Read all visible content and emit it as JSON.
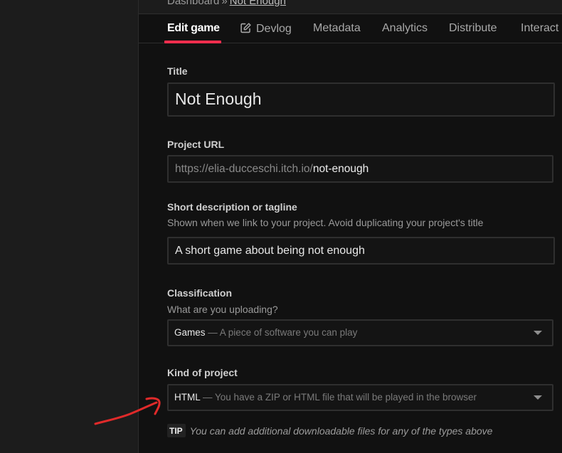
{
  "breadcrumb": {
    "root": "Dashboard",
    "separator": "»",
    "current": "Not Enough"
  },
  "tabs": [
    {
      "label": "Edit game",
      "active": true
    },
    {
      "label": "Devlog",
      "icon": "edit-pencil-icon"
    },
    {
      "label": "Metadata"
    },
    {
      "label": "Analytics"
    },
    {
      "label": "Distribute"
    },
    {
      "label": "Interact"
    }
  ],
  "colors": {
    "accent": "#fa2e4e",
    "annotation": "#e02a2a"
  },
  "form": {
    "title": {
      "label": "Title",
      "value": "Not Enough"
    },
    "project_url": {
      "label": "Project URL",
      "prefix": "https://elia-ducceschi.itch.io/",
      "slug": "not-enough"
    },
    "tagline": {
      "label": "Short description or tagline",
      "hint": "Shown when we link to your project. Avoid duplicating your project's title",
      "value": "A short game about being not enough"
    },
    "classification": {
      "label": "Classification",
      "hint": "What are you uploading?",
      "selected": "Games",
      "selected_desc": "— A piece of software you can play"
    },
    "kind": {
      "label": "Kind of project",
      "selected": "HTML",
      "selected_desc": "— You have a ZIP or HTML file that will be played in the browser"
    },
    "tip": {
      "badge": "TIP",
      "text": "You can add additional downloadable files for any of the types above"
    }
  }
}
